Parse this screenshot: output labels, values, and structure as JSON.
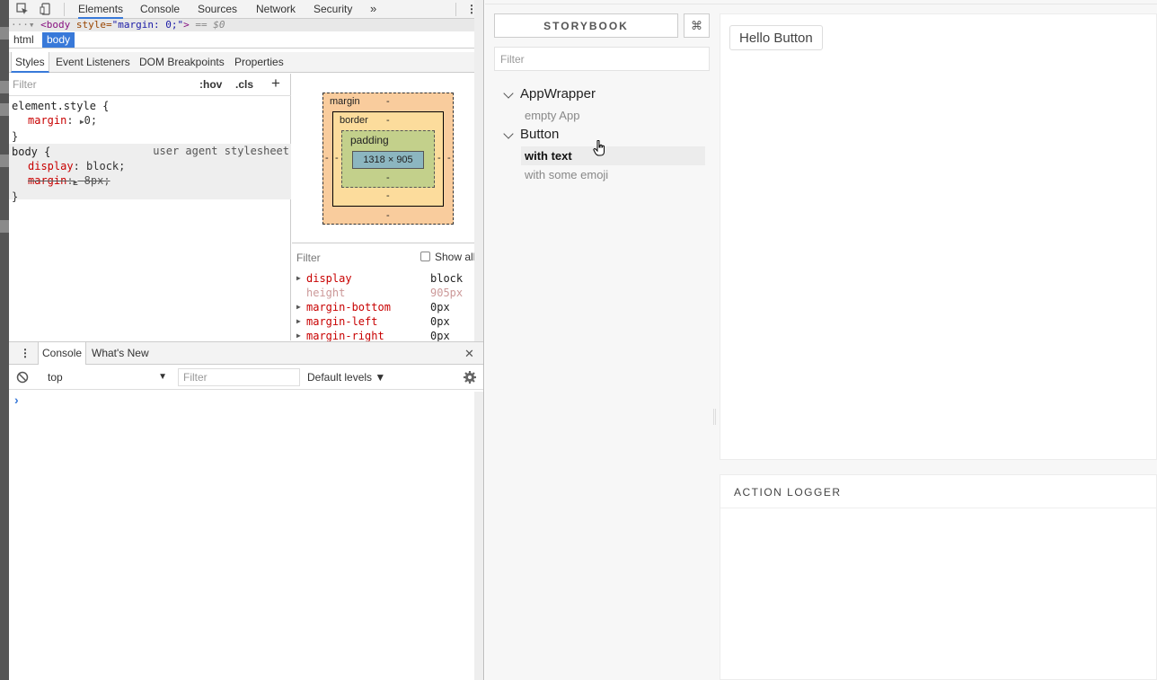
{
  "devtools": {
    "tabs": [
      "Elements",
      "Console",
      "Sources",
      "Network",
      "Security"
    ],
    "more_tabs": "»",
    "menu_icon": "⋮",
    "dom_line": {
      "prefix": "···▾",
      "open": "<body",
      "attr": "style=",
      "value": "\"margin: 0;\"",
      "close": ">",
      "eq": "== $0"
    },
    "breadcrumbs": [
      "html",
      "body"
    ],
    "subtabs": [
      "Styles",
      "Event Listeners",
      "DOM Breakpoints",
      "Properties"
    ],
    "styles": {
      "filter_placeholder": "Filter",
      "hov": ":hov",
      "cls": ".cls",
      "add": "+",
      "element_style": {
        "selector": "element.style {",
        "prop": "margin",
        "value": "0;",
        "close": "}"
      },
      "body_rule": {
        "selector": "body {",
        "source": "user agent stylesheet",
        "prop1": "display",
        "val1": "block;",
        "prop2": "margin",
        "val2": "8px;",
        "close": "}"
      }
    },
    "box_model": {
      "margin_label": "margin",
      "border_label": "border",
      "padding_label": "padding",
      "content": "1318 × 905",
      "dash": "-"
    },
    "computed": {
      "filter_placeholder": "Filter",
      "show_all": "Show all",
      "props": [
        {
          "name": "display",
          "value": "block",
          "dim": false
        },
        {
          "name": "height",
          "value": "905px",
          "dim": true
        },
        {
          "name": "margin-bottom",
          "value": "0px",
          "dim": false
        },
        {
          "name": "margin-left",
          "value": "0px",
          "dim": false
        },
        {
          "name": "margin-right",
          "value": "0px",
          "dim": false
        }
      ]
    },
    "drawer": {
      "tabs": [
        "Console",
        "What's New"
      ],
      "close": "✕",
      "context": "top",
      "filter_placeholder": "Filter",
      "levels": "Default levels ▼",
      "prompt": "›"
    }
  },
  "storybook": {
    "title": "STORYBOOK",
    "shortcut": "⌘",
    "filter_placeholder": "Filter",
    "kinds": [
      {
        "name": "AppWrapper",
        "stories": [
          "empty App"
        ]
      },
      {
        "name": "Button",
        "stories": [
          "with text",
          "with some emoji"
        ]
      }
    ],
    "selected_story": "with text",
    "preview_button": "Hello Button",
    "action_logger": "ACTION LOGGER"
  },
  "colors": {
    "accent": "#3879d9",
    "prop_name": "#c80000",
    "margin_box": "#f9cc9d",
    "border_box": "#fcdc9c",
    "padding_box": "#c3d08b",
    "content_box": "#8cb6c0"
  }
}
